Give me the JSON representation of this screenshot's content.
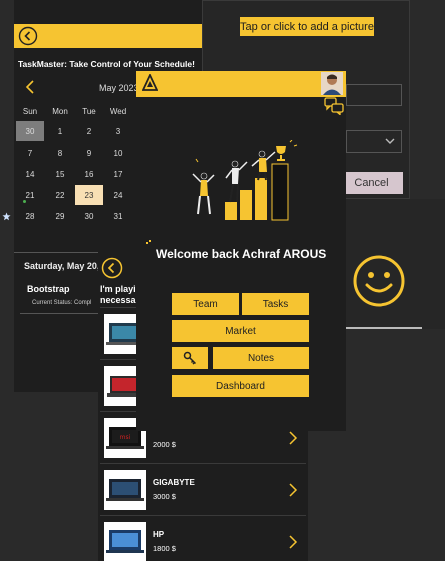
{
  "picture_window": {
    "add_picture_label": "Tap or click to add a picture",
    "cancel_label": "Cancel"
  },
  "taskmaster": {
    "title": "TaskMaster: Take Control of Your Schedule!",
    "calendar": {
      "month": "May 2023",
      "weekdays": [
        "Sun",
        "Mon",
        "Tue",
        "Wed"
      ],
      "weeks": [
        [
          "30",
          "1",
          "2",
          "3"
        ],
        [
          "7",
          "8",
          "9",
          "10"
        ],
        [
          "14",
          "15",
          "16",
          "17"
        ],
        [
          "21",
          "22",
          "23",
          "24"
        ],
        [
          "28",
          "29",
          "30",
          "31"
        ]
      ]
    },
    "selected_date": "Saturday, May 20,",
    "task_name": "Bootstrap",
    "task_status": "Current Status: Compl"
  },
  "market": {
    "title": "I'm playi necessar",
    "products": [
      {
        "name": "",
        "price": ""
      },
      {
        "name": "",
        "price": ""
      },
      {
        "name": "",
        "price": "2000 $"
      },
      {
        "name": "GIGABYTE",
        "price": "3000 $"
      },
      {
        "name": "HP",
        "price": "1800 $"
      }
    ]
  },
  "main": {
    "welcome": "Welcome back Achraf AROUS",
    "buttons": {
      "team": "Team",
      "tasks": "Tasks",
      "market": "Market",
      "notes": "Notes",
      "dashboard": "Dashboard"
    }
  },
  "colors": {
    "accent": "#f6c431",
    "background": "#1e1e1e",
    "today_highlight": "#f8dfb4"
  },
  "icons": [
    "back-icon",
    "chevron-left-icon",
    "chevron-right-icon",
    "chevron-down-icon",
    "logo-icon",
    "chat-icon",
    "key-icon",
    "smiley-icon",
    "star-icon"
  ]
}
